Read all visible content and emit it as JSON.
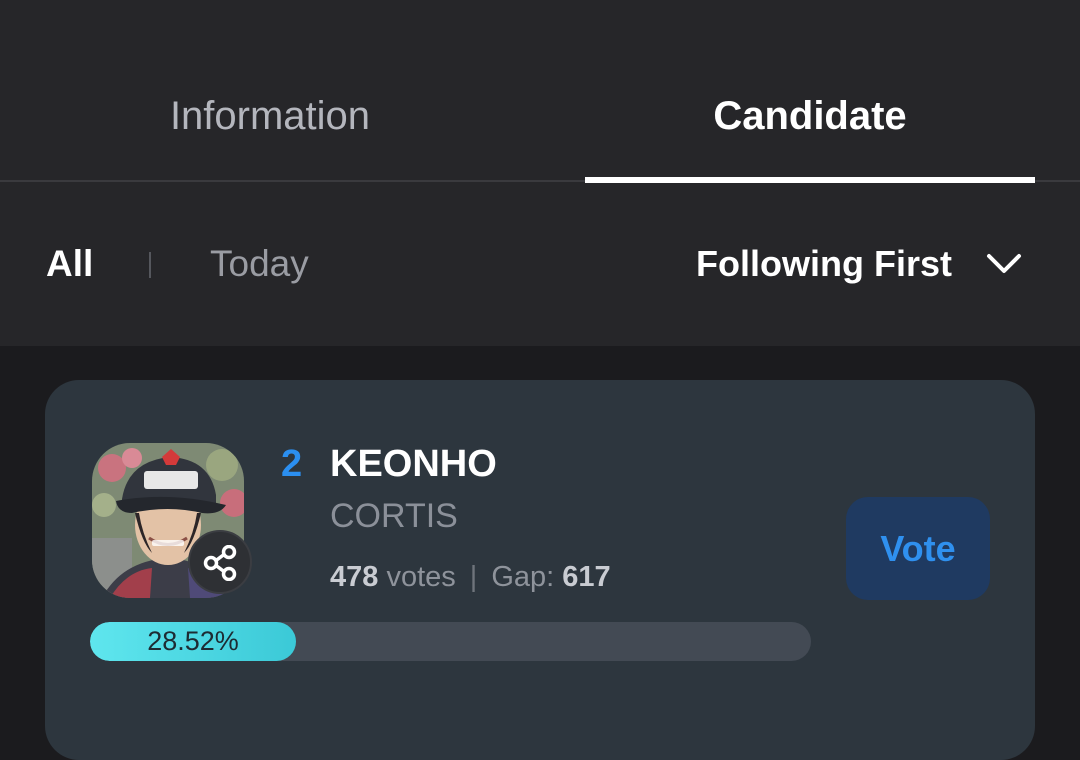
{
  "tabs": [
    {
      "label": "Information",
      "active": false
    },
    {
      "label": "Candidate",
      "active": true
    }
  ],
  "filters": {
    "all": "All",
    "today": "Today",
    "active": "All"
  },
  "sort": {
    "selected": "Following First",
    "icon": "chevron-down-icon"
  },
  "candidate": {
    "rank": "2",
    "name": "KEONHO",
    "group": "CORTIS",
    "votes_count": "478",
    "votes_label": "votes",
    "gap_label": "Gap:",
    "gap_value": "617",
    "progress_text": "28.52%",
    "progress_percent": 28.52,
    "vote_label": "Vote",
    "share_icon": "share-icon"
  },
  "colors": {
    "accent_blue": "#2b8ff0",
    "progress_fill": "#4fd9e3",
    "vote_button_bg": "#1f3a61",
    "card_bg": "#2d363e"
  }
}
